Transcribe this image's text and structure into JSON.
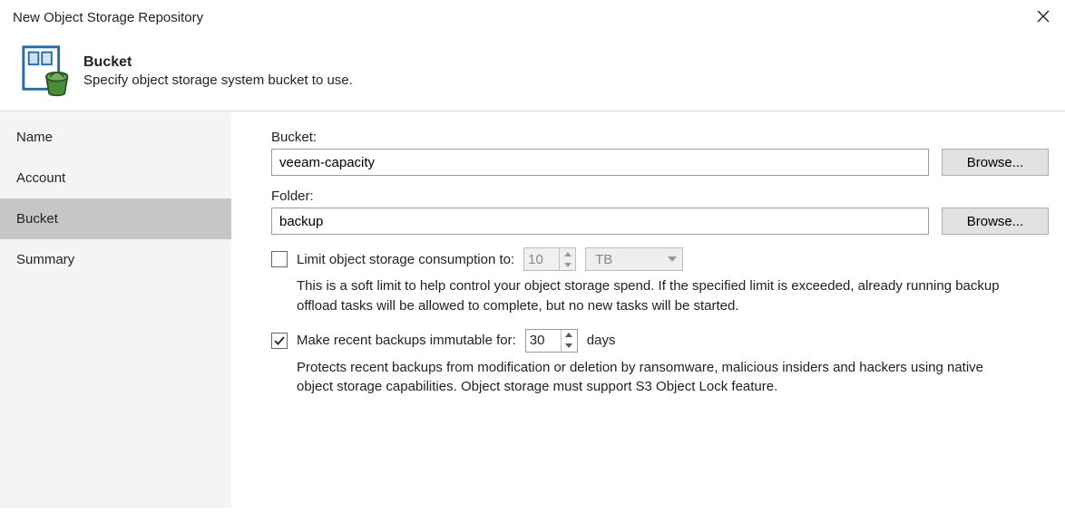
{
  "titlebar": {
    "title": "New Object Storage Repository"
  },
  "banner": {
    "heading": "Bucket",
    "sub": "Specify object storage system bucket to use."
  },
  "sidebar": {
    "items": [
      {
        "label": "Name"
      },
      {
        "label": "Account"
      },
      {
        "label": "Bucket",
        "active": true
      },
      {
        "label": "Summary"
      }
    ]
  },
  "main": {
    "bucket_label": "Bucket:",
    "bucket_value": "veeam-capacity",
    "bucket_browse": "Browse...",
    "folder_label": "Folder:",
    "folder_value": "backup",
    "folder_browse": "Browse...",
    "limit": {
      "checked": false,
      "label": "Limit object storage consumption to:",
      "value": "10",
      "unit": "TB",
      "desc": "This is a soft limit to help control your object storage spend. If the specified limit is exceeded, already running backup offload tasks will be allowed to complete, but no new tasks will be started."
    },
    "immutable": {
      "checked": true,
      "label": "Make recent backups immutable for:",
      "value": "30",
      "unit": "days",
      "desc": "Protects recent backups from modification or deletion by ransomware, malicious insiders and hackers using native object storage capabilities. Object storage must support S3 Object Lock feature."
    }
  }
}
